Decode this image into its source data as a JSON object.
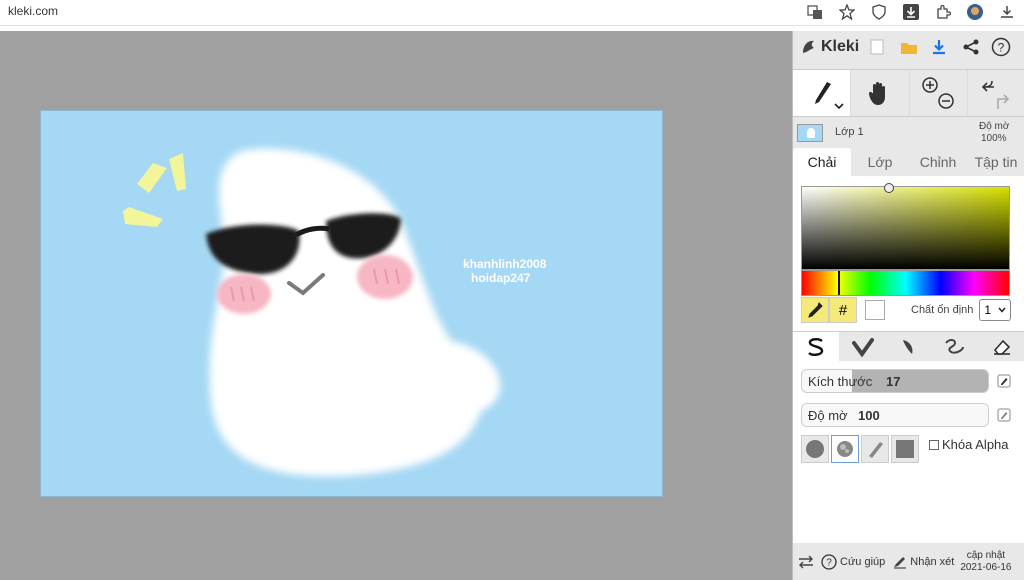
{
  "browser": {
    "url": "kleki.com"
  },
  "canvas": {
    "watermark_line1": "khanhlinh2008",
    "watermark_line2": "hoidap247",
    "background": "#a5d8f4"
  },
  "panel": {
    "logo_text": "Kleki",
    "layer": {
      "name": "Lớp 1",
      "opacity_label": "Độ mờ",
      "opacity_value": "100%"
    },
    "tabs": [
      "Chải",
      "Lớp",
      "Chỉnh",
      "Tập tin"
    ],
    "color": {
      "hash": "#",
      "stabilizer_label": "Chất ổn định",
      "stabilizer_value": "1",
      "hue_selected": "#ff0000"
    },
    "size_slider": {
      "label": "Kích thước",
      "value": "17",
      "fraction": 0.27
    },
    "opacity_slider": {
      "label": "Độ mờ",
      "value": "100",
      "fraction": 1.0
    },
    "alpha_lock_label": "Khóa Alpha",
    "footer": {
      "help": "Cứu giúp",
      "feedback": "Nhận xét",
      "update_line1": "cập nhật",
      "update_line2": "2021-06-16"
    }
  },
  "accent": "#1a73e8"
}
